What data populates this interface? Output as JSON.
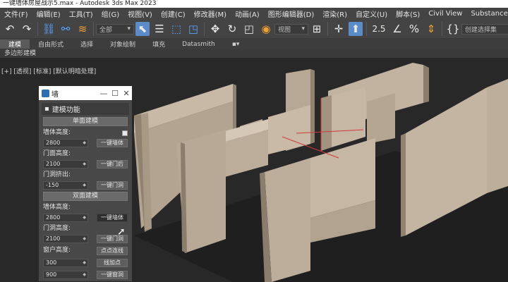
{
  "app": {
    "title": "一键墙体房屋战示5.max - Autodesk 3ds Max 2023"
  },
  "menu": [
    "文件(F)",
    "编辑(E)",
    "工具(T)",
    "组(G)",
    "视图(V)",
    "创建(C)",
    "修改器(M)",
    "动画(A)",
    "图形编辑器(D)",
    "渲染(R)",
    "自定义(U)",
    "脚本(S)",
    "Civil View",
    "Substance"
  ],
  "toolbar": {
    "filter_dropdown": "全部",
    "view_dropdown": "视图",
    "selection_set_dropdown": "创建选择集",
    "snap_label": "2.5"
  },
  "ribbon": {
    "tabs": [
      "建模",
      "自由形式",
      "选择",
      "对象绘制",
      "填充",
      "Datasmith"
    ],
    "active_tab": 0,
    "sub_label": "多边形建模"
  },
  "viewport": {
    "label": "[+] [透视] [标准] [默认明暗处理]"
  },
  "panel": {
    "title": "墙",
    "rollout": "建模功能",
    "single": {
      "header": "单面建模",
      "wall_height_label": "墙体高度:",
      "wall_height": "2800",
      "build_wall": "一键墙体",
      "door_height_label": "门面高度:",
      "door_height": "2100",
      "build_door": "一键门后",
      "hole_label": "门洞挤出:",
      "hole": "-150",
      "build_hole": "一键门洞"
    },
    "double": {
      "header": "双面建模",
      "wall_height_label": "墙体高度:",
      "wall_height": "2800",
      "build_wall": "一键墙体",
      "door_height_label": "门洞高度:",
      "door_height": "2100",
      "build_door": "一键门洞",
      "window_label": "窗户高度:",
      "window_height": "300",
      "connect_points": "点点连线",
      "line_points": "线加点",
      "extra_value": "900",
      "build_window": "一键窗洞"
    }
  }
}
